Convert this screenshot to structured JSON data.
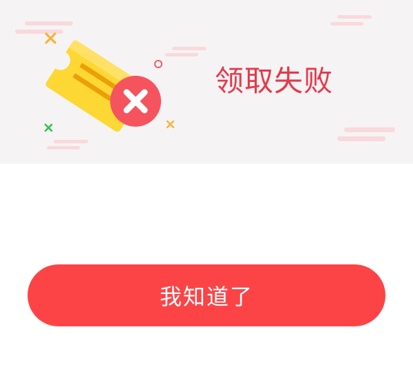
{
  "dialog": {
    "title": "领取失败",
    "confirm_label": "我知道了"
  },
  "colors": {
    "header_bg": "#f6f3f4",
    "title": "#e5384a",
    "button_bg": "#fc4447",
    "button_text": "#ffffff",
    "ticket_yellow": "#fdd835",
    "error_badge": "#f5545e"
  },
  "icons": {
    "illustration": "ticket-with-x-icon",
    "badge": "close-icon"
  }
}
